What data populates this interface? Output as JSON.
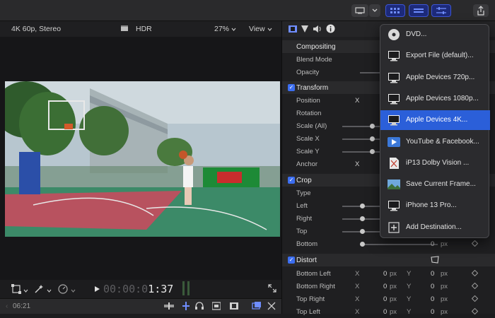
{
  "viewer_header": {
    "format": "4K 60p, Stereo",
    "hdr_label": "HDR",
    "zoom": "27%",
    "view_label": "View"
  },
  "transport": {
    "timecode_dim": "00:00:0",
    "timecode_bright": "1:37"
  },
  "timeline_bar": {
    "time": "06:21"
  },
  "inspector": {
    "compositing": {
      "title": "Compositing",
      "blend_mode": "Blend Mode",
      "opacity": "Opacity"
    },
    "transform": {
      "title": "Transform",
      "position": "Position",
      "rotation": "Rotation",
      "scale_all": "Scale (All)",
      "scale_x": "Scale X",
      "scale_y": "Scale Y",
      "anchor": "Anchor",
      "x_axis": "X"
    },
    "crop": {
      "title": "Crop",
      "type": "Type",
      "left": "Left",
      "right": "Right",
      "top": "Top",
      "bottom": "Bottom",
      "bottom_value": "0",
      "unit": "px"
    },
    "distort": {
      "title": "Distort",
      "rows": [
        {
          "label": "Bottom Left",
          "x": "0",
          "y": "0"
        },
        {
          "label": "Bottom Right",
          "x": "0",
          "y": "0"
        },
        {
          "label": "Top Right",
          "x": "0",
          "y": "0"
        },
        {
          "label": "Top Left",
          "x": "0",
          "y": "0"
        }
      ],
      "x_axis": "X",
      "y_axis": "Y",
      "unit": "px"
    }
  },
  "share_menu": {
    "items": [
      {
        "label": "DVD...",
        "icon": "dvd-icon"
      },
      {
        "label": "Export File (default)...",
        "icon": "computer-icon"
      },
      {
        "label": "Apple Devices 720p...",
        "icon": "computer-icon"
      },
      {
        "label": "Apple Devices 1080p...",
        "icon": "computer-icon"
      },
      {
        "label": "Apple Devices 4K...",
        "icon": "computer-icon",
        "selected": true
      },
      {
        "label": "YouTube & Facebook...",
        "icon": "youtube-icon"
      },
      {
        "label": "iP13 Dolby Vision ...",
        "icon": "file-icon"
      },
      {
        "label": "Save Current Frame...",
        "icon": "image-icon"
      },
      {
        "label": "iPhone 13 Pro...",
        "icon": "computer-icon"
      },
      {
        "label": "Add Destination...",
        "icon": "plus-icon"
      }
    ]
  },
  "colors": {
    "accent": "#2b5fd9",
    "checkbox": "#3c6ef0"
  }
}
